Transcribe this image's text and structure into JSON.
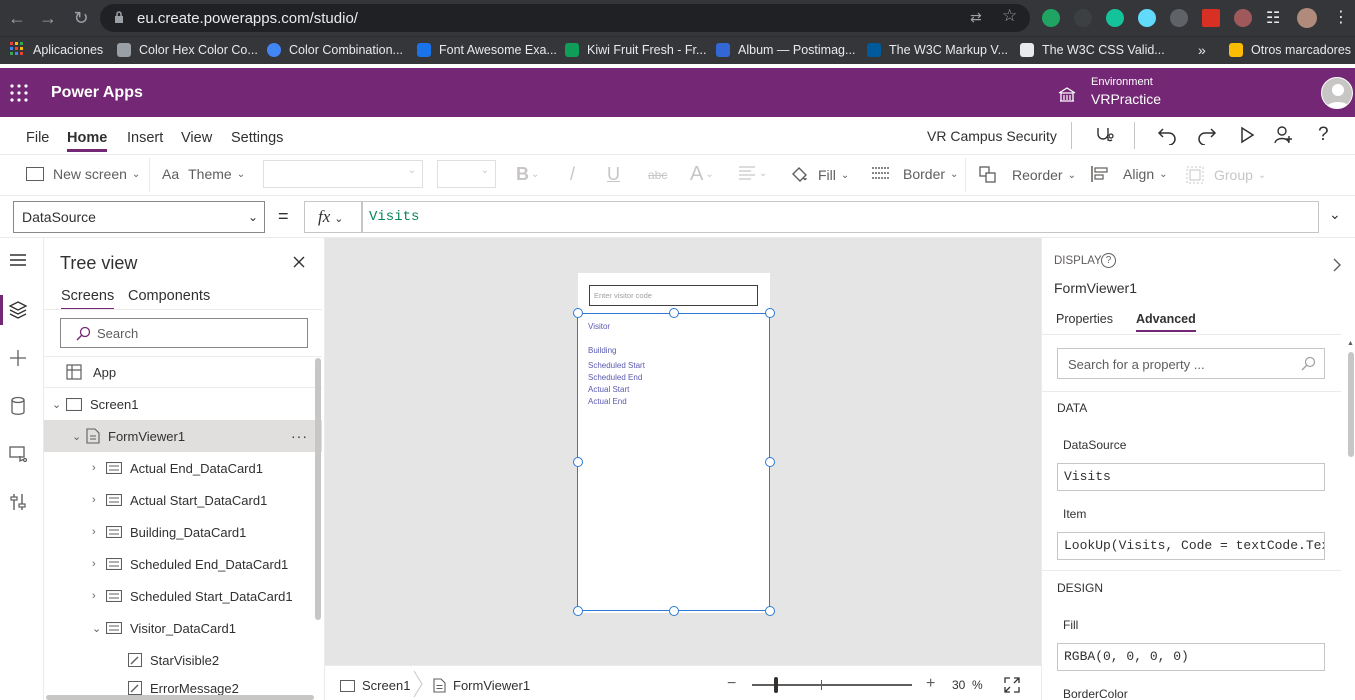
{
  "browser": {
    "url": "eu.create.powerapps.com/studio/",
    "bookmarks": [
      {
        "label": "Aplicaciones",
        "color": "#ea4335"
      },
      {
        "label": "Color Hex Color Co...",
        "color": "#9aa0a6"
      },
      {
        "label": "Color Combination...",
        "color": "#4285f4"
      },
      {
        "label": "Font Awesome Exa...",
        "color": "#1a73e8"
      },
      {
        "label": "Kiwi Fruit Fresh - Fr...",
        "color": "#0f9d58"
      },
      {
        "label": "Album — Postimag...",
        "color": "#3367d6"
      },
      {
        "label": "The W3C Markup V...",
        "color": "#005a9c"
      },
      {
        "label": "The W3C CSS Valid...",
        "color": "#e8eaed"
      }
    ],
    "more_label": "»",
    "other_bookmarks": "Otros marcadores"
  },
  "header": {
    "app_name": "Power Apps",
    "environment_label": "Environment",
    "environment_name": "VRPractice",
    "brand_color": "#742774"
  },
  "menu": {
    "items": [
      "File",
      "Home",
      "Insert",
      "View",
      "Settings"
    ],
    "active": "Home",
    "app_title": "VR Campus Security"
  },
  "ribbon": {
    "new_screen": "New screen",
    "theme": "Theme",
    "bold": "B",
    "italic": "/",
    "underline": "U",
    "strike": "abc",
    "font_size_icon": "A",
    "fill": "Fill",
    "border": "Border",
    "reorder": "Reorder",
    "align": "Align",
    "group": "Group"
  },
  "formula_bar": {
    "property": "DataSource",
    "equals": "=",
    "fx": "fx",
    "formula": "Visits"
  },
  "tree_view": {
    "title": "Tree view",
    "tabs": [
      "Screens",
      "Components"
    ],
    "active_tab": "Screens",
    "search_placeholder": "Search",
    "nodes": [
      {
        "label": "App",
        "type": "app"
      },
      {
        "label": "Screen1",
        "type": "screen"
      },
      {
        "label": "FormViewer1",
        "type": "form"
      },
      {
        "label": "Actual End_DataCard1",
        "type": "card"
      },
      {
        "label": "Actual Start_DataCard1",
        "type": "card"
      },
      {
        "label": "Building_DataCard1",
        "type": "card"
      },
      {
        "label": "Scheduled End_DataCard1",
        "type": "card"
      },
      {
        "label": "Scheduled Start_DataCard1",
        "type": "card"
      },
      {
        "label": "Visitor_DataCard1",
        "type": "card"
      },
      {
        "label": "StarVisible2",
        "type": "control"
      },
      {
        "label": "ErrorMessage2",
        "type": "control"
      }
    ],
    "more_menu": "···"
  },
  "canvas": {
    "code_placeholder": "Enter visitor code",
    "fields": [
      "Visitor",
      "Building",
      "Scheduled Start",
      "Scheduled End",
      "Actual Start",
      "Actual End"
    ],
    "breadcrumbs": [
      "Screen1",
      "FormViewer1"
    ],
    "zoom_value": "30",
    "zoom_unit": "%",
    "zoom_minus": "−",
    "zoom_plus": "+"
  },
  "properties": {
    "section_label": "DISPLAY",
    "control_name": "FormViewer1",
    "tabs": [
      "Properties",
      "Advanced"
    ],
    "active_tab": "Advanced",
    "search_placeholder": "Search for a property ...",
    "data_header": "DATA",
    "datasource_label": "DataSource",
    "datasource_value": "Visits",
    "item_label": "Item",
    "item_value": "LookUp(Visits, Code = textCode.Text)",
    "design_header": "DESIGN",
    "fill_label": "Fill",
    "fill_value": "RGBA(0, 0, 0, 0)",
    "bordercolor_label": "BorderColor"
  }
}
